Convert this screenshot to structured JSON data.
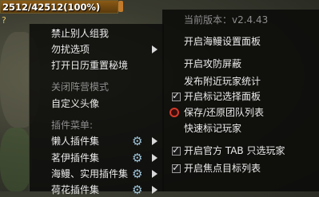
{
  "hud": {
    "hp_text": "2512/42512(100%)",
    "hp_fraction": 1.0,
    "stub_text": "?"
  },
  "left_menu": {
    "items": [
      {
        "label": "禁止别人组我"
      },
      {
        "label": "勿扰选项"
      },
      {
        "label": "打开日历重置秘境"
      },
      {
        "label": "关闭阵营模式"
      },
      {
        "label": "自定义头像"
      },
      {
        "label": "插件菜单:"
      },
      {
        "label": "懒人插件集"
      },
      {
        "label": "茗伊插件集"
      },
      {
        "label": "海鳗、实用插件集"
      },
      {
        "label": "荷花插件集"
      }
    ]
  },
  "right_menu": {
    "version": "当前版本：v2.4.43",
    "items": [
      {
        "label": "开启海鳗设置面板"
      },
      {
        "label": "开启攻防屏蔽"
      },
      {
        "label": "发布附近玩家统计"
      },
      {
        "label": "开启标记选择面板",
        "checked": true
      },
      {
        "label": "保存/还原团队列表"
      },
      {
        "label": "快速标记玩家"
      },
      {
        "label": "开启官方 TAB 只选玩家",
        "checked": true
      },
      {
        "label": "开启焦点目标列表",
        "checked": true
      }
    ]
  },
  "icons": {
    "submenu_arrow": "chevron-right-icon",
    "settings": "gear-icon",
    "checkbox_checked": "check-icon",
    "radio_selected": "radio-icon"
  },
  "colors": {
    "menu_bg": "#0c0c0a",
    "menu_text": "#ececec",
    "header_text": "#8e8e8e",
    "radio_red": "#d23a2a",
    "gear_blue": "#9fc4d8",
    "hp_fill": "#8a5a16"
  }
}
